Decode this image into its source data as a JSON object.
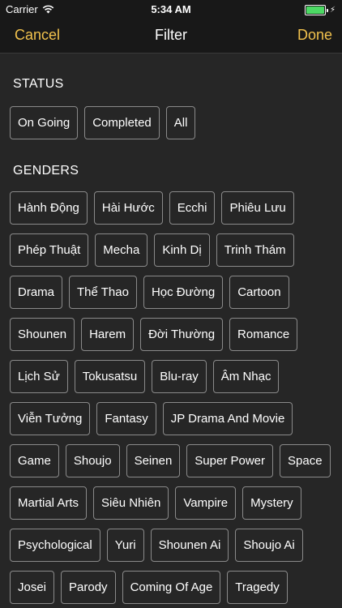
{
  "status_bar": {
    "carrier": "Carrier",
    "time": "5:34 AM",
    "battery_level": 1.0,
    "wifi_icon": "wifi-icon",
    "charging_icon": "bolt-icon",
    "battery_color": "#4cd964"
  },
  "nav": {
    "cancel_label": "Cancel",
    "title": "Filter",
    "done_label": "Done",
    "accent_color": "#f2c24d"
  },
  "status": {
    "title": "STATUS",
    "options": [
      "On Going",
      "Completed",
      "All"
    ]
  },
  "genders": {
    "title": "GENDERS",
    "options": [
      "Hành Động",
      "Hài Hước",
      "Ecchi",
      "Phiêu Lưu",
      "Phép Thuật",
      "Mecha",
      "Kinh Dị",
      "Trinh Thám",
      "Drama",
      "Thể Thao",
      "Học Đường",
      "Cartoon",
      "Shounen",
      "Harem",
      "Đời Thường",
      "Romance",
      "Lịch Sử",
      "Tokusatsu",
      "Blu-ray",
      "Âm Nhạc",
      "Viễn Tưởng",
      "Fantasy",
      "JP Drama And Movie",
      "Game",
      "Shoujo",
      "Seinen",
      "Super Power",
      "Space",
      "Martial Arts",
      "Siêu Nhiên",
      "Vampire",
      "Mystery",
      "Psychological",
      "Yuri",
      "Shounen Ai",
      "Shoujo Ai",
      "Josei",
      "Parody",
      "Coming Of Age",
      "Tragedy"
    ]
  }
}
